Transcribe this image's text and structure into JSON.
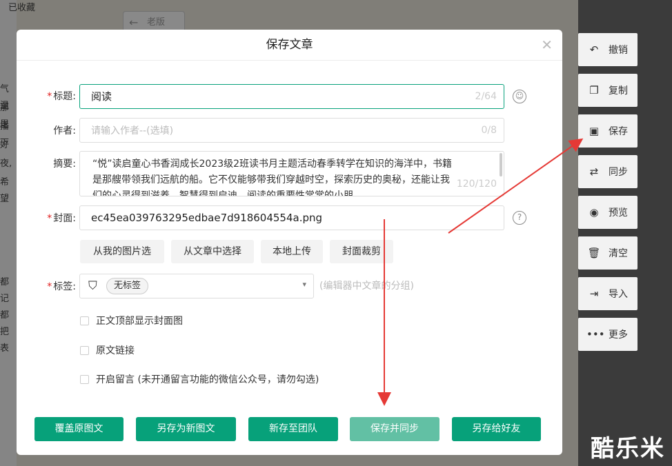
{
  "background": {
    "favorites_label": "已收藏",
    "old_version_label": "老版",
    "left_fragments": [
      "气温",
      "那里",
      "播下",
      "好",
      "夜,",
      "希望",
      "都",
      "记",
      "都",
      "把",
      "表"
    ]
  },
  "dialog": {
    "title": "保存文章",
    "fields": {
      "title": {
        "label": "标题:",
        "value": "阅读",
        "counter": "2/64"
      },
      "author": {
        "label": "作者:",
        "placeholder": "请输入作者--(选填)",
        "counter": "0/8"
      },
      "summary": {
        "label": "摘要:",
        "value": "“悦”读启童心书香润成长2023级2班读书月主题活动春季转学在知识的海洋中，书籍是那艘带领我们远航的船。它不仅能够带我们穿越时空，探索历史的奥秘，还能让我们的心灵得到滋养，智慧得到启迪。阅读的重要性常常的小朋",
        "counter": "120/120"
      },
      "cover": {
        "label": "封面:",
        "value": "ec45ea039763295edbae7d918604554a.png"
      },
      "tags": {
        "label": "标签:",
        "chip": "无标签",
        "hint": "(编辑器中文章的分组)"
      }
    },
    "cover_buttons": [
      "从我的图片选",
      "从文章中选择",
      "本地上传",
      "封面裁剪"
    ],
    "checkboxes": [
      "正文顶部显示封面图",
      "原文链接",
      "开启留言 (未开通留言功能的微信公众号，请勿勾选)"
    ],
    "footer_buttons": [
      "覆盖原图文",
      "另存为新图文",
      "新存至团队",
      "保存并同步",
      "另存给好友"
    ]
  },
  "toolbar": {
    "items": [
      {
        "label": "撤销",
        "icon": "undo-icon"
      },
      {
        "label": "复制",
        "icon": "copy-icon"
      },
      {
        "label": "保存",
        "icon": "save-icon"
      },
      {
        "label": "同步",
        "icon": "sync-icon"
      },
      {
        "label": "预览",
        "icon": "eye-icon"
      },
      {
        "label": "清空",
        "icon": "trash-icon"
      },
      {
        "label": "导入",
        "icon": "import-icon"
      },
      {
        "label": "更多",
        "icon": "more-icon"
      }
    ]
  },
  "watermark": "酷乐米",
  "colors": {
    "primary": "#07a17a",
    "primary_light": "#62c0a4",
    "required": "#e02020",
    "annotation": "#e53935"
  }
}
